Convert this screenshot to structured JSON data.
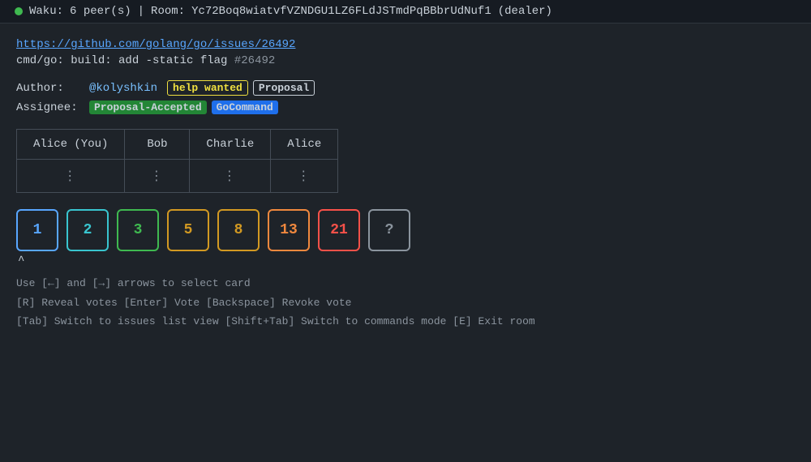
{
  "topbar": {
    "status_dot_color": "#3fb950",
    "app_name": "Waku:",
    "peers": "6 peer(s)",
    "separator": "|",
    "room_label": "Room:",
    "room_id": "Yc72Boq8wiatvfVZNDGU1LZ6FLdJSTmdPqBBbrUdNuf1",
    "role": "(dealer)"
  },
  "issue": {
    "link_text": "https://github.com/golang/go/issues/26492",
    "link_url": "https://github.com/golang/go/issues/26492",
    "title": "cmd/go: build: add -static flag",
    "number": "#26492",
    "author_label": "Author:",
    "author_value": "@kolyshkin",
    "assignee_label": "Assignee:",
    "tags": [
      {
        "text": "help wanted",
        "style": "yellow"
      },
      {
        "text": "Proposal",
        "style": "white"
      },
      {
        "text": "Proposal-Accepted",
        "style": "green"
      },
      {
        "text": "GoCommand",
        "style": "blue"
      }
    ]
  },
  "voters": {
    "headers": [
      "Alice (You)",
      "Bob",
      "Charlie",
      "Alice"
    ],
    "votes": [
      "⋮",
      "⋮",
      "⋮",
      "⋮"
    ]
  },
  "cards": [
    {
      "value": "1",
      "style": "color-blue"
    },
    {
      "value": "2",
      "style": "color-cyan"
    },
    {
      "value": "3",
      "style": "color-green"
    },
    {
      "value": "5",
      "style": "color-yellow"
    },
    {
      "value": "8",
      "style": "color-yellow"
    },
    {
      "value": "13",
      "style": "color-orange"
    },
    {
      "value": "21",
      "style": "color-red"
    },
    {
      "value": "?",
      "style": "color-gray"
    }
  ],
  "selected_card_index": 0,
  "caret": "^",
  "help": {
    "line1": "Use [←] and [→] arrows to select card",
    "line2": "[R] Reveal votes  [Enter] Vote  [Backspace] Revoke vote",
    "line3": "[Tab] Switch to issues list view  [Shift+Tab] Switch to commands mode  [E] Exit room"
  }
}
